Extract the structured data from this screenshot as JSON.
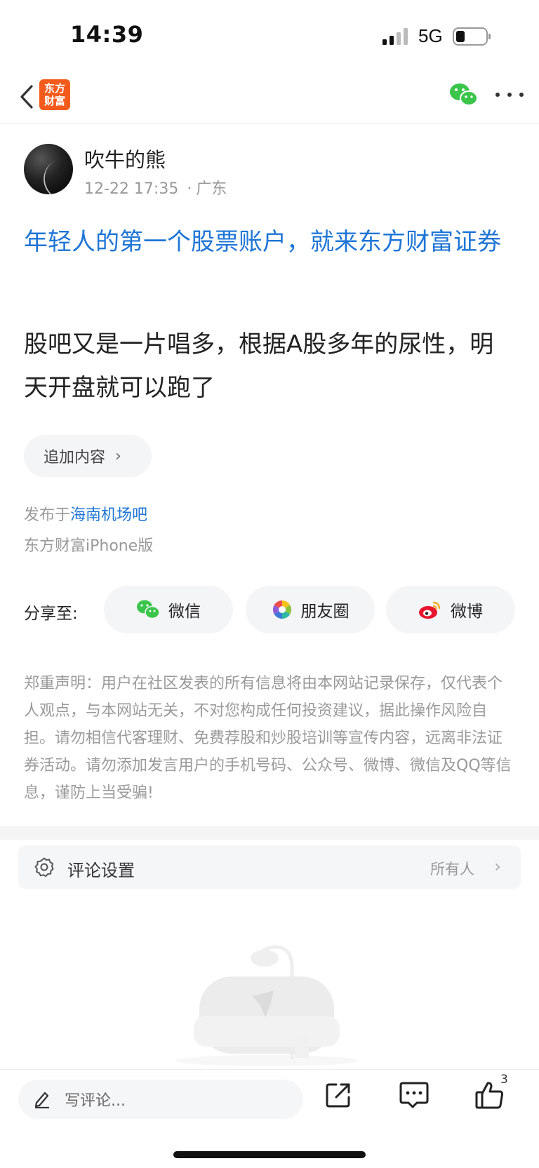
{
  "status_bar": {
    "time": "14:39",
    "network": "5G"
  },
  "nav": {
    "logo_text": "东方财富"
  },
  "author": {
    "name": "吹牛的熊",
    "time": "12-22 17:35",
    "location": "广东"
  },
  "ad_title": "年轻人的第一个股票账户，就来东方财富证券",
  "post_body": "股吧又是一片唱多，根据A股多年的尿性，明天开盘就可以跑了",
  "append_label": "追加内容",
  "published": {
    "prefix": "发布于",
    "bar_name": "海南机场吧",
    "client": "东方财富iPhone版"
  },
  "share": {
    "label": "分享至:",
    "wechat": "微信",
    "moments": "朋友圈",
    "weibo": "微博"
  },
  "disclaimer": "郑重声明：用户在社区发表的所有信息将由本网站记录保存，仅代表个人观点，与本网站无关，不对您构成任何投资建议，据此操作风险自担。请勿相信代客理财、免费荐股和炒股培训等宣传内容，远离非法证券活动。请勿添加发言用户的手机号码、公众号、微博、微信及QQ等信息，谨防上当受骗!",
  "comment_settings": {
    "label": "评论设置",
    "value": "所有人"
  },
  "bottom_bar": {
    "comment_placeholder": "写评论...",
    "like_count": "3"
  },
  "colors": {
    "link_blue": "#1d75d6",
    "brand_orange": "#f35b1c",
    "wechat_green": "#3bc54b"
  }
}
